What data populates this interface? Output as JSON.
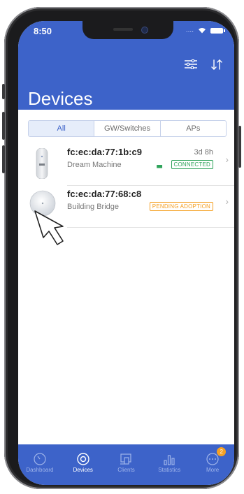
{
  "status_bar": {
    "time": "8:50"
  },
  "header": {
    "title": "Devices",
    "filter_icon": "sliders-icon",
    "sort_icon": "sort-arrows-icon"
  },
  "tabs": [
    "All",
    "GW/Switches",
    "APs"
  ],
  "devices": [
    {
      "mac": "fc:ec:da:77:1b:c9",
      "model": "Dream Machine",
      "uptime": "3d 8h",
      "status": "CONNECTED",
      "status_color": "#2ea35a"
    },
    {
      "mac": "fc:ec:da:77:68:c8",
      "model": "Building Bridge",
      "uptime": "",
      "status": "PENDING ADOPTION",
      "status_color": "#f5a023"
    }
  ],
  "tabbar": {
    "items": [
      {
        "label": "Dashboard",
        "icon": "dashboard-icon"
      },
      {
        "label": "Devices",
        "icon": "devices-icon"
      },
      {
        "label": "Clients",
        "icon": "clients-icon"
      },
      {
        "label": "Statistics",
        "icon": "statistics-icon"
      },
      {
        "label": "More",
        "icon": "more-icon",
        "badge": "2"
      }
    ]
  },
  "colors": {
    "accent": "#3d63c9",
    "connected": "#2ea35a",
    "pending": "#f5a023"
  }
}
